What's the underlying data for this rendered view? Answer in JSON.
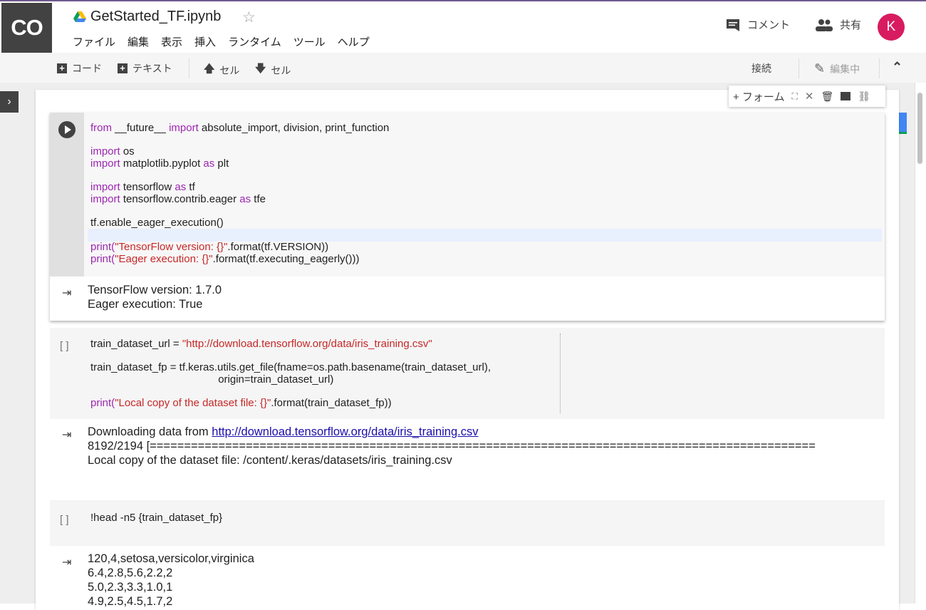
{
  "app": {
    "logo": "CO",
    "title": "GetStarted_TF.ipynb"
  },
  "menu": [
    "ファイル",
    "編集",
    "表示",
    "挿入",
    "ランタイム",
    "ツール",
    "ヘルプ"
  ],
  "header_right": {
    "comment": "コメント",
    "share": "共有",
    "avatar": "K"
  },
  "toolbar": {
    "code": "コード",
    "text": "テキスト",
    "cell_up": "セル",
    "cell_down": "セル",
    "connect": "接続",
    "editing": "編集中"
  },
  "cell_toolbar": {
    "form": "+ フォーム"
  },
  "cell1": {
    "lines": [
      {
        "parts": [
          [
            "kw",
            "from "
          ],
          [
            "",
            "__future__ "
          ],
          [
            "kw",
            "import "
          ],
          [
            "",
            "absolute_import, division, print_function"
          ]
        ]
      },
      {
        "parts": [
          [
            "kw",
            "import "
          ],
          [
            "",
            "os"
          ]
        ]
      },
      {
        "parts": [
          [
            "kw",
            "import "
          ],
          [
            "",
            "matplotlib.pyplot "
          ],
          [
            "kw",
            "as "
          ],
          [
            "",
            "plt"
          ]
        ]
      },
      {
        "parts": [
          [
            "kw",
            "import "
          ],
          [
            "",
            "tensorflow "
          ],
          [
            "kw",
            "as "
          ],
          [
            "",
            "tf"
          ]
        ]
      },
      {
        "parts": [
          [
            "kw",
            "import "
          ],
          [
            "",
            "tensorflow.contrib.eager "
          ],
          [
            "kw",
            "as "
          ],
          [
            "",
            "tfe"
          ]
        ]
      },
      {
        "parts": [
          [
            "",
            "tf.enable_eager_execution()"
          ]
        ]
      },
      {
        "parts": [
          [
            "fn",
            "print("
          ],
          [
            "str",
            "\"TensorFlow version: {}\""
          ],
          [
            "",
            ".format(tf.VERSION))"
          ]
        ]
      },
      {
        "parts": [
          [
            "fn",
            "print("
          ],
          [
            "str",
            "\"Eager execution: {}\""
          ],
          [
            "",
            ".format(tf.executing_eagerly()))"
          ]
        ]
      }
    ],
    "output": "TensorFlow version: 1.7.0\nEager execution: True"
  },
  "cell2": {
    "bracket": "[ ]",
    "line1_var": "train_dataset_url = ",
    "line1_str": "\"http://download.tensorflow.org/data/iris_training.csv\"",
    "line2": "train_dataset_fp = tf.keras.utils.get_file(fname=os.path.basename(train_dataset_url),",
    "line3": "                                           origin=train_dataset_url)",
    "line4_fn": "print(",
    "line4_str": "\"Local copy of the dataset file: {}\"",
    "line4_rest": ".format(train_dataset_fp))",
    "out_prefix": "Downloading data from ",
    "out_link": "http://download.tensorflow.org/data/iris_training.csv",
    "out_progress": "8192/2194 [=================================================================================================",
    "out_local": "Local copy of the dataset file: /content/.keras/datasets/iris_training.csv"
  },
  "cell3": {
    "bracket": "[ ]",
    "code": "!head -n5 {train_dataset_fp}",
    "output": "120,4,setosa,versicolor,virginica\n6.4,2.8,5.6,2.2,2\n5.0,2.3,3.3,1.0,1\n4.9,2.5,4.5,1.7,2"
  }
}
